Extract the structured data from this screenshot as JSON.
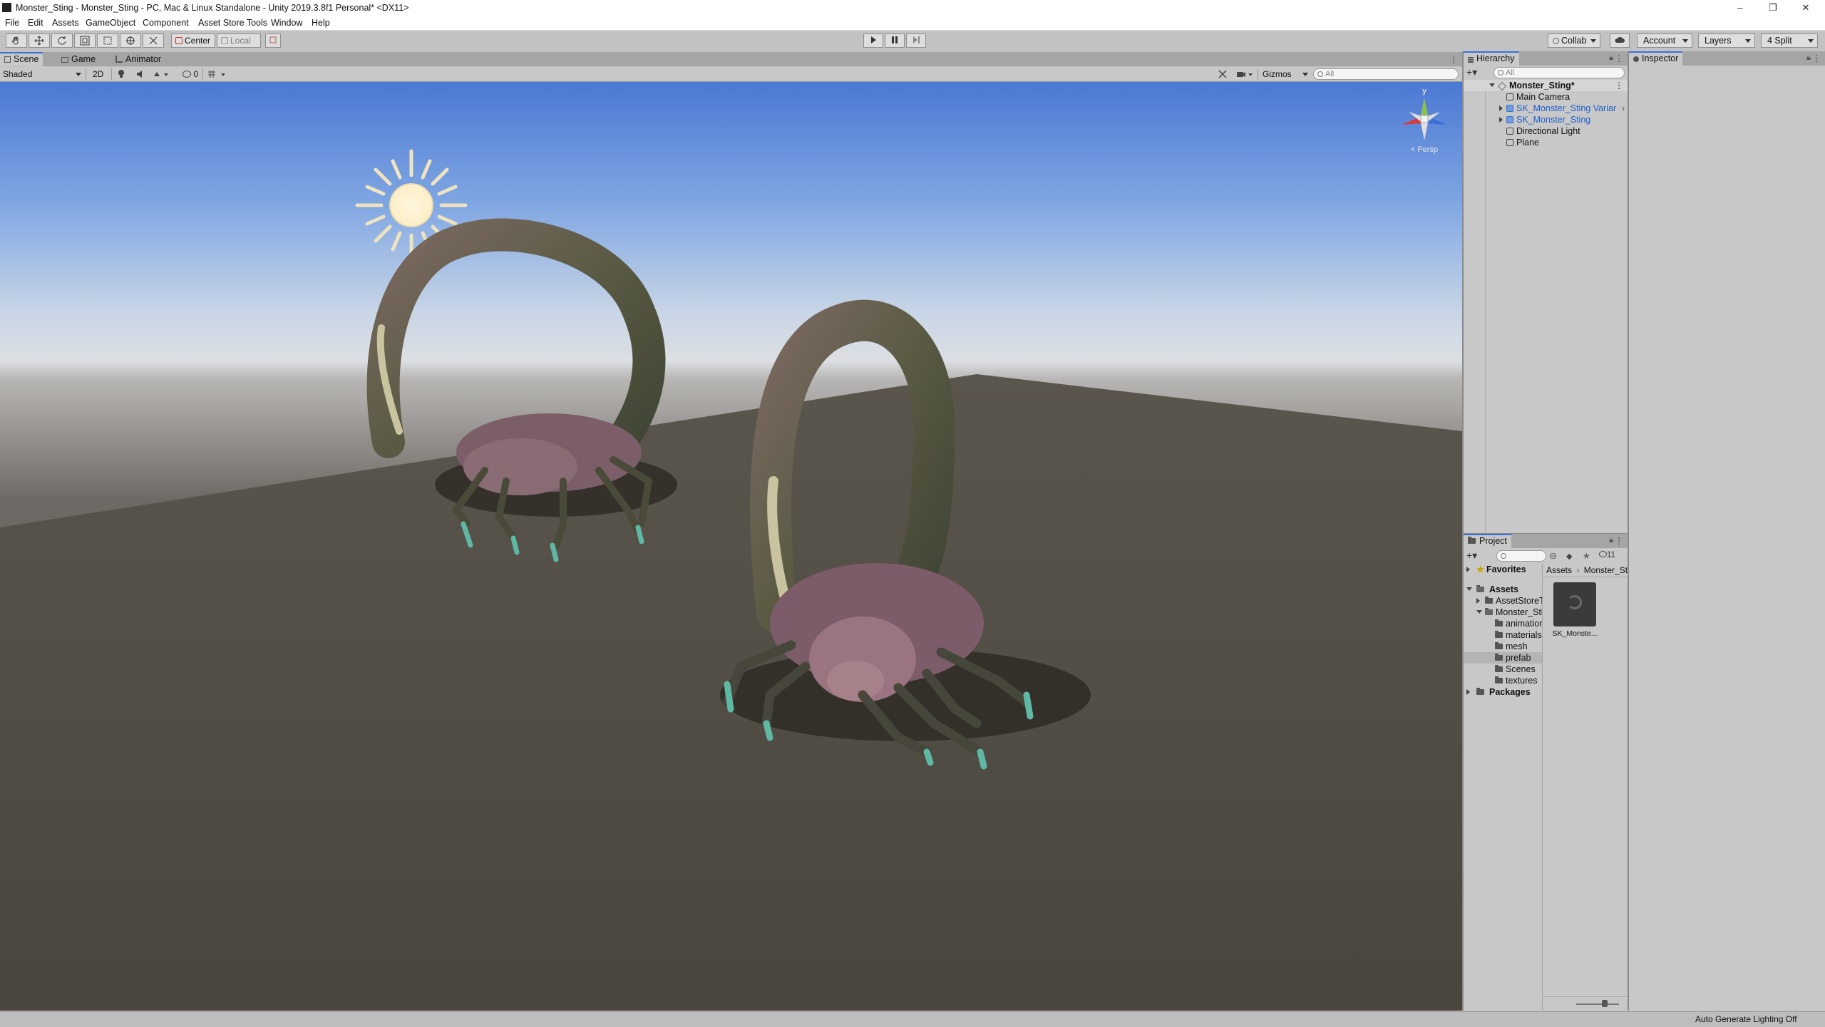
{
  "window": {
    "title": "Monster_Sting - Monster_Sting - PC, Mac & Linux Standalone - Unity 2019.3.8f1 Personal* <DX11>",
    "controls": {
      "minimize": "–",
      "restore": "❐",
      "close": "✕"
    }
  },
  "menu": [
    "File",
    "Edit",
    "Assets",
    "GameObject",
    "Component",
    "Asset Store Tools",
    "Window",
    "Help"
  ],
  "toolbar": {
    "pivot_mode": "Center",
    "pivot_rotation": "Local",
    "collab": "Collab",
    "account": "Account",
    "layers": "Layers",
    "layout": "4 Split"
  },
  "scene_tabs": [
    "Scene",
    "Game",
    "Animator"
  ],
  "scene_toolbar": {
    "draw_mode": "Shaded",
    "mode_2d": "2D",
    "hidden_count": "0",
    "gizmos": "Gizmos",
    "search_placeholder": "All"
  },
  "scene_gizmo": {
    "axis_y": "y",
    "persp": "< Persp"
  },
  "hierarchy": {
    "tab": "Hierarchy",
    "search_placeholder": "All",
    "scene": "Monster_Sting*",
    "items": [
      {
        "label": "Main Camera",
        "prefab": false
      },
      {
        "label": "SK_Monster_Sting Variant",
        "prefab": true
      },
      {
        "label": "SK_Monster_Sting",
        "prefab": true
      },
      {
        "label": "Directional Light",
        "prefab": false
      },
      {
        "label": "Plane",
        "prefab": false
      }
    ]
  },
  "inspector": {
    "tab": "Inspector"
  },
  "project": {
    "tab": "Project",
    "hidden_count": "11",
    "favorites": "Favorites",
    "assets": "Assets",
    "packages": "Packages",
    "asset_children": [
      "AssetStoreTools",
      "Monster_Sting"
    ],
    "monster_children": [
      "animations",
      "materials",
      "mesh",
      "prefab",
      "Scenes",
      "textures"
    ],
    "selected_folder": "prefab",
    "breadcrumb": [
      "Assets",
      "Monster_Sting"
    ],
    "asset_thumb_label": "SK_Monste..."
  },
  "status": {
    "lighting": "Auto Generate Lighting Off"
  },
  "colors": {
    "editor_bg": "#c2c2c2",
    "panel_bg": "#c8c8c8",
    "tab_active_accent": "#3a72d8",
    "sky_top": "#4b78d3",
    "horizon": "#d9dce0",
    "ground": "#4c473e",
    "prefab_text": "#1f5fc7"
  }
}
